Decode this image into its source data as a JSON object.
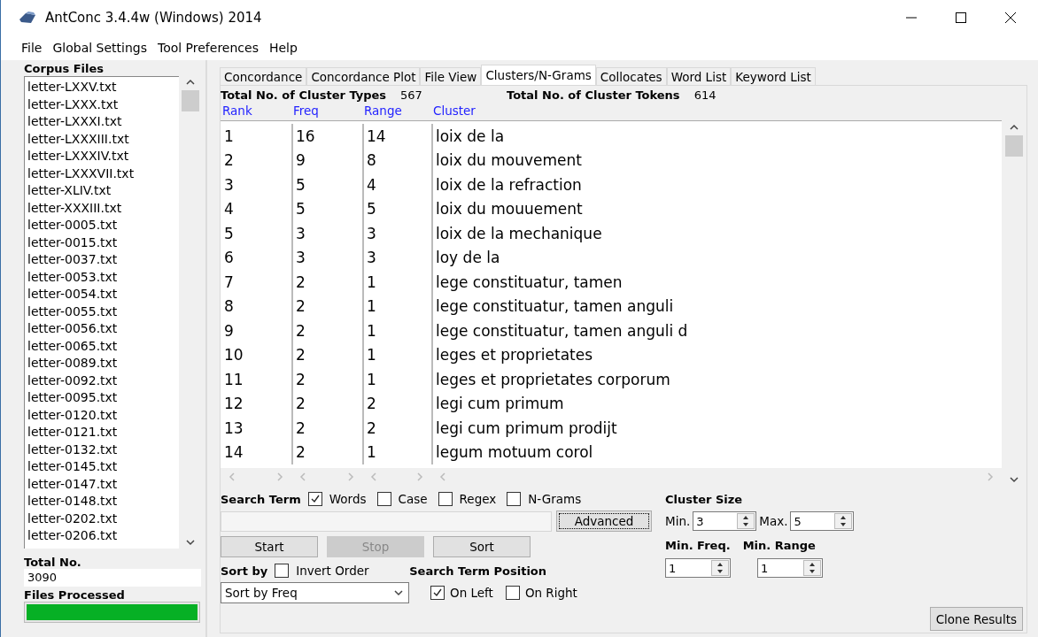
{
  "window": {
    "title": "AntConc 3.4.4w (Windows) 2014"
  },
  "menu": [
    "File",
    "Global Settings",
    "Tool Preferences",
    "Help"
  ],
  "sidebar": {
    "label": "Corpus Files",
    "files": [
      "letter-LXXV.txt",
      "letter-LXXX.txt",
      "letter-LXXXI.txt",
      "letter-LXXXIII.txt",
      "letter-LXXXIV.txt",
      "letter-LXXXVII.txt",
      "letter-XLIV.txt",
      "letter-XXXIII.txt",
      "letter-0005.txt",
      "letter-0015.txt",
      "letter-0037.txt",
      "letter-0053.txt",
      "letter-0054.txt",
      "letter-0055.txt",
      "letter-0056.txt",
      "letter-0065.txt",
      "letter-0089.txt",
      "letter-0092.txt",
      "letter-0095.txt",
      "letter-0120.txt",
      "letter-0121.txt",
      "letter-0132.txt",
      "letter-0145.txt",
      "letter-0147.txt",
      "letter-0148.txt",
      "letter-0202.txt",
      "letter-0206.txt"
    ],
    "total_label": "Total No.",
    "total_value": "3090",
    "processed_label": "Files Processed",
    "progress": {
      "level": 1
    }
  },
  "tabs": [
    {
      "label": "Concordance",
      "selected": false
    },
    {
      "label": "Concordance Plot",
      "selected": false
    },
    {
      "label": "File View",
      "selected": false
    },
    {
      "label": "Clusters/N-Grams",
      "selected": true
    },
    {
      "label": "Collocates",
      "selected": false
    },
    {
      "label": "Word List",
      "selected": false
    },
    {
      "label": "Keyword List",
      "selected": false
    }
  ],
  "stats": [
    {
      "label": "Total No. of Cluster Types",
      "value": "567"
    },
    {
      "label": "Total No. of Cluster Tokens",
      "value": "614"
    }
  ],
  "table": {
    "columns": [
      "Rank",
      "Freq",
      "Range",
      "Cluster"
    ],
    "rows": [
      [
        "1",
        "16",
        "14",
        "loix de la"
      ],
      [
        "2",
        "9",
        "8",
        "loix du mouvement"
      ],
      [
        "3",
        "5",
        "4",
        "loix de la refraction"
      ],
      [
        "4",
        "5",
        "5",
        "loix du mouuement"
      ],
      [
        "5",
        "3",
        "3",
        "loix de la mechanique"
      ],
      [
        "6",
        "3",
        "3",
        "loy de la"
      ],
      [
        "7",
        "2",
        "1",
        "lege constituatur, tamen"
      ],
      [
        "8",
        "2",
        "1",
        "lege constituatur, tamen anguli"
      ],
      [
        "9",
        "2",
        "1",
        "lege constituatur, tamen anguli d"
      ],
      [
        "10",
        "2",
        "1",
        "leges et proprietates"
      ],
      [
        "11",
        "2",
        "1",
        "leges et proprietates corporum"
      ],
      [
        "12",
        "2",
        "2",
        "legi cum primum"
      ],
      [
        "13",
        "2",
        "2",
        "legi cum primum prodijt"
      ],
      [
        "14",
        "2",
        "1",
        "legum motuum corol"
      ]
    ]
  },
  "search": {
    "label": "Search Term",
    "options": [
      {
        "label": "Words",
        "checked": true
      },
      {
        "label": "Case",
        "checked": false
      },
      {
        "label": "Regex",
        "checked": false
      },
      {
        "label": "N-Grams",
        "checked": false
      }
    ],
    "advanced": {
      "label": "Advanced",
      "focused": true
    }
  },
  "buttons": [
    {
      "label": "Start",
      "disabled": false
    },
    {
      "label": "Stop",
      "disabled": true
    },
    {
      "label": "Sort",
      "disabled": false
    }
  ],
  "sort": {
    "label": "Sort by",
    "invert": {
      "label": "Invert Order",
      "checked": false
    },
    "value": "Sort by Freq"
  },
  "position": {
    "label": "Search Term Position",
    "options": [
      {
        "label": "On Left",
        "checked": true
      },
      {
        "label": "On Right",
        "checked": false
      }
    ]
  },
  "cluster_size": {
    "label": "Cluster Size",
    "min_label": "Min.",
    "min": "3",
    "max_label": "Max.",
    "max": "5"
  },
  "min_freq": {
    "label": "Min. Freq.",
    "value": "1"
  },
  "min_range": {
    "label": "Min. Range",
    "value": "1"
  },
  "clone_button": "Clone Results"
}
